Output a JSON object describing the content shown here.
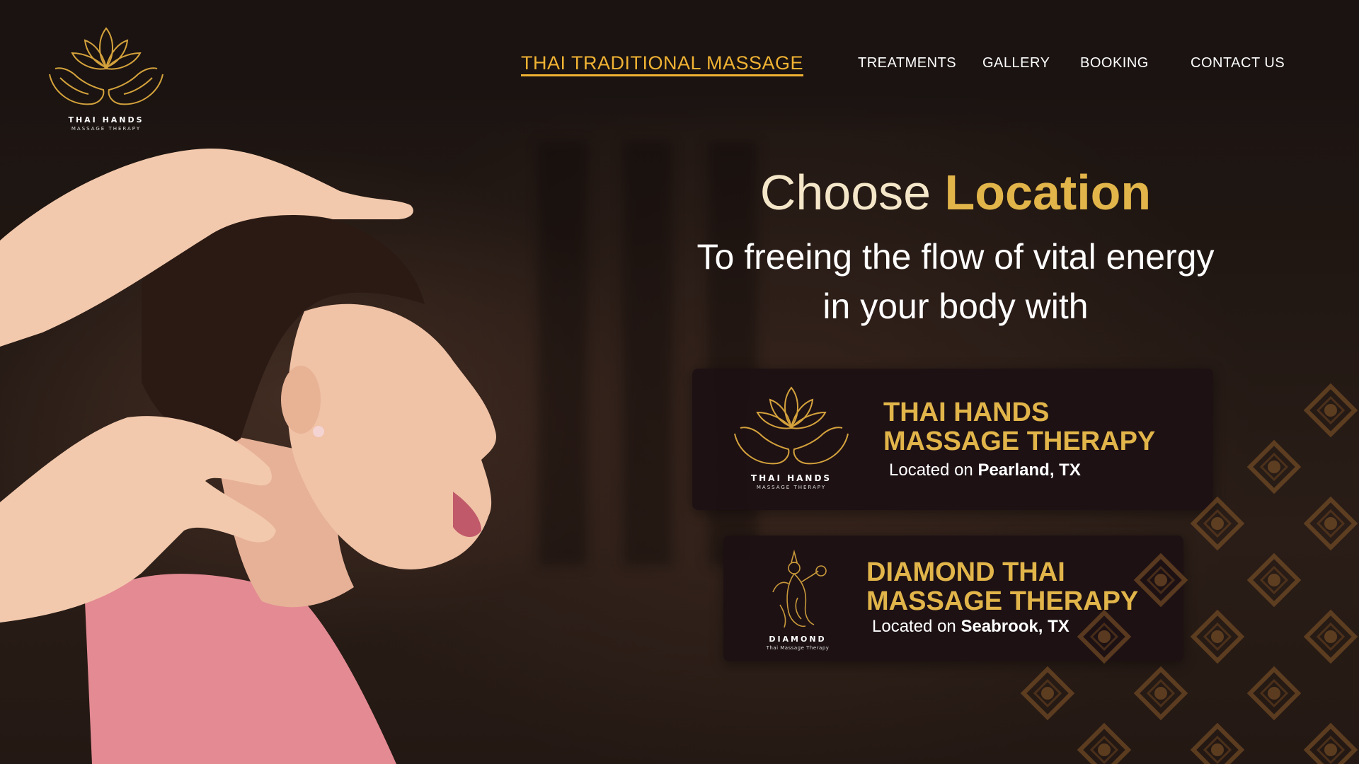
{
  "brand": {
    "logo_line1": "THAI HANDS",
    "logo_line2": "MASSAGE THERAPY"
  },
  "nav": {
    "items": [
      {
        "label": "THAI TRADITIONAL MASSAGE",
        "active": true
      },
      {
        "label": "TREATMENTS"
      },
      {
        "label": "GALLERY"
      },
      {
        "label": "BOOKING"
      },
      {
        "label": "CONTACT US"
      }
    ]
  },
  "hero": {
    "title_plain": "Choose ",
    "title_accent": "Location",
    "subtitle_line1": "To freeing the flow of vital energy",
    "subtitle_line2": "in your body with"
  },
  "locations": [
    {
      "name_line1": "THAI HANDS",
      "name_line2": "MASSAGE THERAPY",
      "located_prefix": "Located on ",
      "city": "Pearland, TX",
      "logo_line1": "THAI HANDS",
      "logo_line2": "MASSAGE THERAPY"
    },
    {
      "name_line1": "DIAMOND THAI",
      "name_line2": "MASSAGE THERAPY",
      "located_prefix": "Located on ",
      "city": "Seabrook, TX",
      "logo_line1": "DIAMOND",
      "logo_line2": "Thai Massage Therapy"
    }
  ],
  "colors": {
    "gold": "#e2b54a",
    "nav_active": "#f0b233",
    "background": "#1a1210"
  },
  "icons": {
    "logo": "lotus-hands-icon",
    "location1": "lotus-hands-icon",
    "location2": "thai-dancer-icon"
  }
}
